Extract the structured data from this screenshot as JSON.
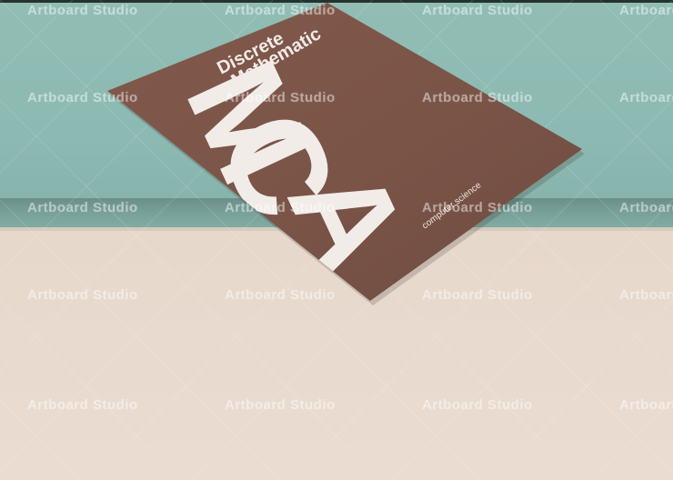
{
  "poster": {
    "title_line_1": "Discrete",
    "title_line_2": "Mathematic",
    "big_letter_1": "M",
    "big_letter_2": "C",
    "big_letter_3": "A",
    "subtitle": "computer science"
  },
  "watermark": {
    "text": "Artboard Studio"
  },
  "colors": {
    "wall": "#8cb9b1",
    "floor": "#e8d9cd",
    "poster": "#7b5548",
    "poster_text": "#f2ece8"
  }
}
